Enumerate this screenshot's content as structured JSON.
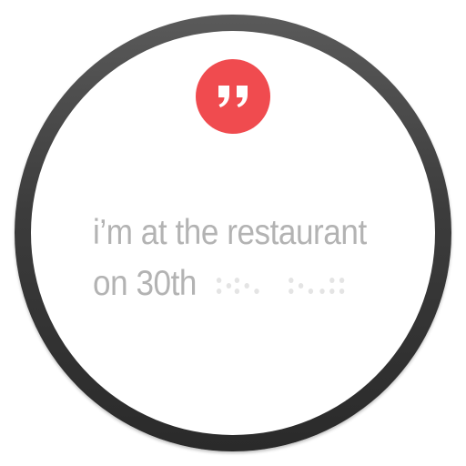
{
  "app": {
    "icon": "quote-icon",
    "accent_color": "#f04b4f"
  },
  "message": {
    "line1": "i’m at the restaurant",
    "line2": "on 30th"
  }
}
